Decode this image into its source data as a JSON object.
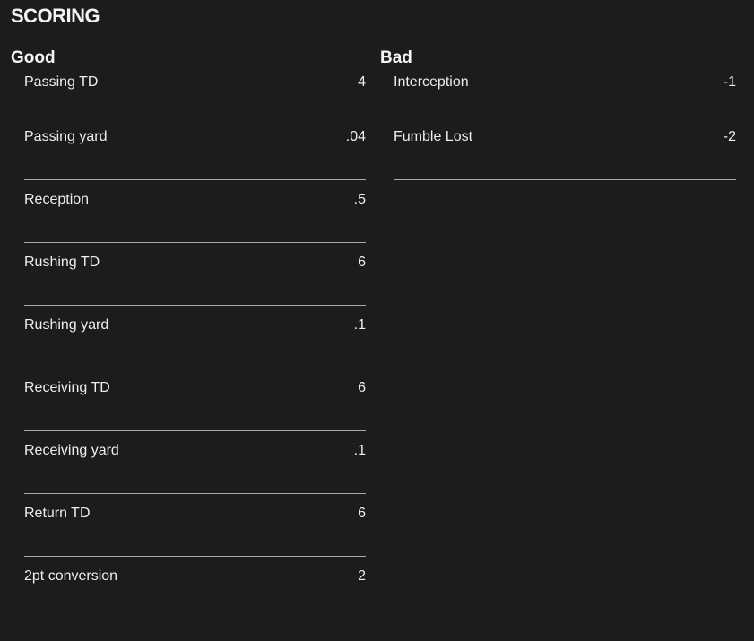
{
  "title": "SCORING",
  "good": {
    "heading": "Good",
    "items": [
      {
        "label": "Passing TD",
        "value": "4"
      },
      {
        "label": "Passing yard",
        "value": ".04"
      },
      {
        "label": "Reception",
        "value": ".5"
      },
      {
        "label": "Rushing TD",
        "value": "6"
      },
      {
        "label": "Rushing yard",
        "value": ".1"
      },
      {
        "label": "Receiving TD",
        "value": "6"
      },
      {
        "label": "Receiving yard",
        "value": ".1"
      },
      {
        "label": "Return TD",
        "value": "6"
      },
      {
        "label": "2pt conversion",
        "value": "2"
      }
    ]
  },
  "bad": {
    "heading": "Bad",
    "items": [
      {
        "label": "Interception",
        "value": "-1"
      },
      {
        "label": "Fumble Lost",
        "value": "-2"
      }
    ]
  }
}
